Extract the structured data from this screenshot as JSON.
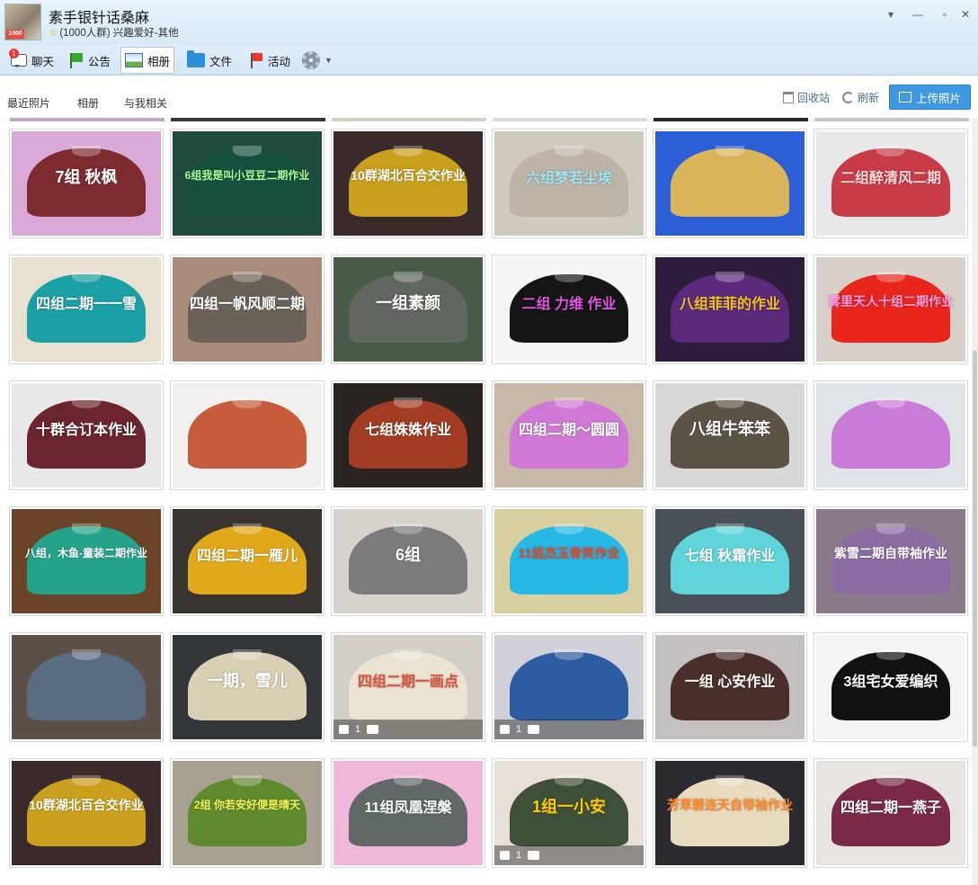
{
  "header": {
    "group_name": "素手银针话桑麻",
    "group_meta": "(1000人群) 兴趣爱好-其他",
    "avatar_badge": "1000"
  },
  "toolbar": {
    "chat": "聊天",
    "chat_badge": "1",
    "notice": "公告",
    "album": "相册",
    "files": "文件",
    "events": "活动"
  },
  "subnav": {
    "recent": "最近照片",
    "albums": "相册",
    "related": "与我相关",
    "recycle": "回收站",
    "refresh": "刷新",
    "upload": "上传照片"
  },
  "photos": [
    {
      "caption": "7组 秋枫",
      "bg": "#d9a9d7",
      "color": "#7d2b2e",
      "text": "#ffffff"
    },
    {
      "caption": "6组我是叫小豆豆二期作业",
      "bg": "#1f4b3c",
      "color": "#15503f",
      "text": "#a8ff9a"
    },
    {
      "caption": "10群湖北百合交作业",
      "bg": "#3a2a2a",
      "color": "#c9a01e",
      "text": "#ffffff"
    },
    {
      "caption": "六组梦若尘埃",
      "bg": "#cfc9c0",
      "color": "#bdb3a6",
      "text": "#9fe6f5"
    },
    {
      "caption": "",
      "bg": "#2c5fd6",
      "color": "#d9b45a",
      "text": "#ffffff"
    },
    {
      "caption": "二组醉清风二期",
      "bg": "#e8e8e8",
      "color": "#c73c48",
      "text": "#ffd7d7"
    },
    {
      "caption": "四组二期一一雪",
      "bg": "#e8e0d0",
      "color": "#1aa0a5",
      "text": "#ffffff"
    },
    {
      "caption": "四组一帆风顺二期",
      "bg": "#a98c7c",
      "color": "#6a6258",
      "text": "#ffffff"
    },
    {
      "caption": "一组素颜",
      "bg": "#4a5a48",
      "color": "#616660",
      "text": "#ffffff"
    },
    {
      "caption": "二组 力维 作业",
      "bg": "#f5f5f5",
      "color": "#151515",
      "text": "#e055e0"
    },
    {
      "caption": "八组菲菲的作业",
      "bg": "#2e1c3c",
      "color": "#5b2a7a",
      "text": "#f0c020"
    },
    {
      "caption": "雾里天人十组二期作业",
      "bg": "#d8d0c8",
      "color": "#e8261b",
      "text": "#ff9be0"
    },
    {
      "caption": "十群合订本作业",
      "bg": "#e8e8e8",
      "color": "#6b2530",
      "text": "#ffffff"
    },
    {
      "caption": "",
      "bg": "#f2f0ee",
      "color": "#c65c3c",
      "text": "#ffffff"
    },
    {
      "caption": "七组姝姝作业",
      "bg": "#2a2420",
      "color": "#a23c22",
      "text": "#ffffff"
    },
    {
      "caption": "四组二期～圆圆",
      "bg": "#c8b8a8",
      "color": "#cf78d6",
      "text": "#ffffff"
    },
    {
      "caption": "八组牛笨笨",
      "bg": "#d8d8d8",
      "color": "#5c5347",
      "text": "#ffffff"
    },
    {
      "caption": "",
      "bg": "#e0e4e8",
      "color": "#c97bd8",
      "text": "#ffffff"
    },
    {
      "caption": "八组，木鱼-童装二期作业",
      "bg": "#6b4428",
      "color": "#24a38a",
      "text": "#ffffff"
    },
    {
      "caption": "四组二期一雁儿",
      "bg": "#3a3430",
      "color": "#e0a81a",
      "text": "#ffffff"
    },
    {
      "caption": "6组",
      "bg": "#d8d2cc",
      "color": "#7c7a7c",
      "text": "#ffffff"
    },
    {
      "caption": "11组杰玉骨笑作业",
      "bg": "#d8cfa0",
      "color": "#27b9e6",
      "text": "#e64a2a"
    },
    {
      "caption": "七组 秋霜作业",
      "bg": "#4a5058",
      "color": "#5fd5da",
      "text": "#ffffff"
    },
    {
      "caption": "紫雪二期自带袖作业",
      "bg": "#8a7a8a",
      "color": "#8b6ca3",
      "text": "#ffffff"
    },
    {
      "caption": "",
      "bg": "#5a5048",
      "color": "#5a6c82",
      "text": "#ffffff"
    },
    {
      "caption": "一期，雪儿",
      "bg": "#323638",
      "color": "#d9cfb5",
      "text": "#ffffff"
    },
    {
      "caption": "四组二期一画点",
      "bg": "#d4cfc6",
      "color": "#ebe4d3",
      "text": "#d9533f"
    },
    {
      "caption": "",
      "bg": "#d0d0d8",
      "color": "#2d5ca0",
      "text": "#ff7a1a"
    },
    {
      "caption": "一组 心安作业",
      "bg": "#c4c0c0",
      "color": "#4a2e2c",
      "text": "#ffffff"
    },
    {
      "caption": "3组宅女爱编织",
      "bg": "#f4f4f4",
      "color": "#111111",
      "text": "#ffffff"
    },
    {
      "caption": "10群湖北百合交作业",
      "bg": "#3a2a2a",
      "color": "#c9a01e",
      "text": "#ffffff"
    },
    {
      "caption": "2组  你若安好便是晴天",
      "bg": "#a8a090",
      "color": "#5f8a2e",
      "text": "#f5f55a"
    },
    {
      "caption": "11组凤凰涅槃",
      "bg": "#f0b8d8",
      "color": "#606868",
      "text": "#ffffff"
    },
    {
      "caption": "1组一小安",
      "bg": "#e8e0d8",
      "color": "#3e4f3a",
      "text": "#ffcc00"
    },
    {
      "caption": "芳草碧连天自带袖作业",
      "bg": "#2a2a30",
      "color": "#e8dcc0",
      "text": "#ff8a2a"
    },
    {
      "caption": "四组二期一燕子",
      "bg": "#e8e4e0",
      "color": "#7a2a48",
      "text": "#ffffff"
    }
  ],
  "like_overlays": [
    {
      "photo_index": 26,
      "likes": "1"
    },
    {
      "photo_index": 27,
      "likes": "1"
    },
    {
      "photo_index": 33,
      "likes": "1"
    }
  ]
}
